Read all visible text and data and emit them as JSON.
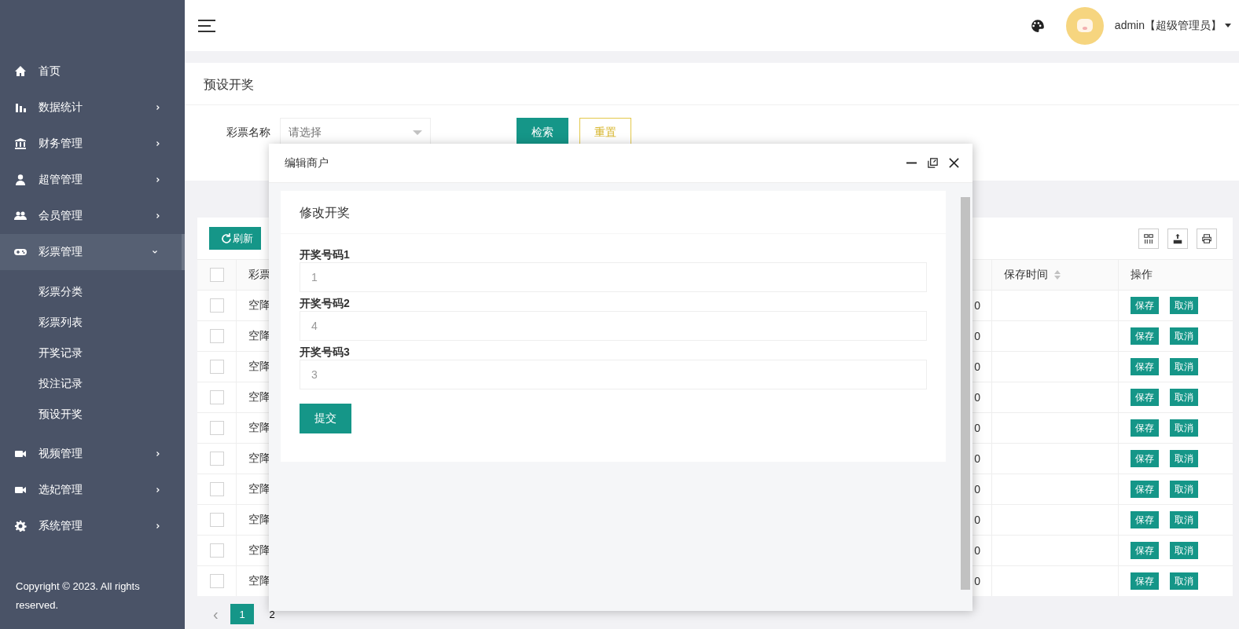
{
  "sidebar": {
    "items": [
      {
        "label": "首页",
        "kind": "link",
        "selected": false
      },
      {
        "label": "数据统计",
        "kind": "menu",
        "expanded": false,
        "selected": false
      },
      {
        "label": "财务管理",
        "kind": "menu",
        "expanded": false,
        "selected": false
      },
      {
        "label": "超管管理",
        "kind": "menu",
        "expanded": false,
        "selected": false
      },
      {
        "label": "会员管理",
        "kind": "menu",
        "expanded": false,
        "selected": false
      },
      {
        "label": "彩票管理",
        "kind": "menu",
        "expanded": true,
        "selected": true,
        "children": [
          {
            "label": "彩票分类",
            "selected": false
          },
          {
            "label": "彩票列表",
            "selected": false
          },
          {
            "label": "开奖记录",
            "selected": false
          },
          {
            "label": "投注记录",
            "selected": false
          },
          {
            "label": "预设开奖",
            "selected": false
          }
        ]
      },
      {
        "label": "视频管理",
        "kind": "menu",
        "expanded": false,
        "selected": false
      },
      {
        "label": "选妃管理",
        "kind": "menu",
        "expanded": false,
        "selected": false
      },
      {
        "label": "系统管理",
        "kind": "menu",
        "expanded": false,
        "selected": false
      }
    ],
    "copyright": "Copyright © 2023. All rights reserved."
  },
  "header": {
    "user": "admin【超级管理员】"
  },
  "page": {
    "title": "预设开奖",
    "filter_label": "彩票名称",
    "filter_placeholder": "请选择",
    "search_button": "检索",
    "reset_button": "重置"
  },
  "toolbar": {
    "refresh": "刷新"
  },
  "table": {
    "header": {
      "checked": false,
      "name": "彩票",
      "save_time": "保存时间",
      "actions": "操作"
    },
    "rows": [
      {
        "checked": false,
        "name": "空降",
        "column_3": "0",
        "actions": [
          "保存",
          "取消"
        ]
      },
      {
        "checked": false,
        "name": "空降",
        "column_3": "0",
        "actions": [
          "保存",
          "取消"
        ]
      },
      {
        "checked": false,
        "name": "空降",
        "column_3": "0",
        "actions": [
          "保存",
          "取消"
        ]
      },
      {
        "checked": false,
        "name": "空降",
        "column_3": "0",
        "actions": [
          "保存",
          "取消"
        ]
      },
      {
        "checked": false,
        "name": "空降",
        "column_3": "0",
        "actions": [
          "保存",
          "取消"
        ]
      },
      {
        "checked": false,
        "name": "空降",
        "column_3": "0",
        "actions": [
          "保存",
          "取消"
        ]
      },
      {
        "checked": false,
        "name": "空降",
        "column_3": "0",
        "actions": [
          "保存",
          "取消"
        ]
      },
      {
        "checked": false,
        "name": "空降",
        "column_3": "0",
        "actions": [
          "保存",
          "取消"
        ]
      },
      {
        "checked": false,
        "name": "空降",
        "column_3": "0",
        "actions": [
          "保存",
          "取消"
        ]
      },
      {
        "checked": false,
        "name": "空降",
        "column_3": "0",
        "actions": [
          "保存",
          "取消"
        ]
      }
    ]
  },
  "pagination": {
    "prev": "‹",
    "pages": [
      {
        "label": "1",
        "selected": true
      },
      {
        "label": "2",
        "selected": false
      }
    ]
  },
  "dialog": {
    "title": "编辑商户",
    "card_title": "修改开奖",
    "fields": [
      {
        "label": "开奖号码1",
        "value": "1"
      },
      {
        "label": "开奖号码2",
        "value": "4"
      },
      {
        "label": "开奖号码3",
        "value": "3"
      }
    ],
    "submit": "提交"
  }
}
